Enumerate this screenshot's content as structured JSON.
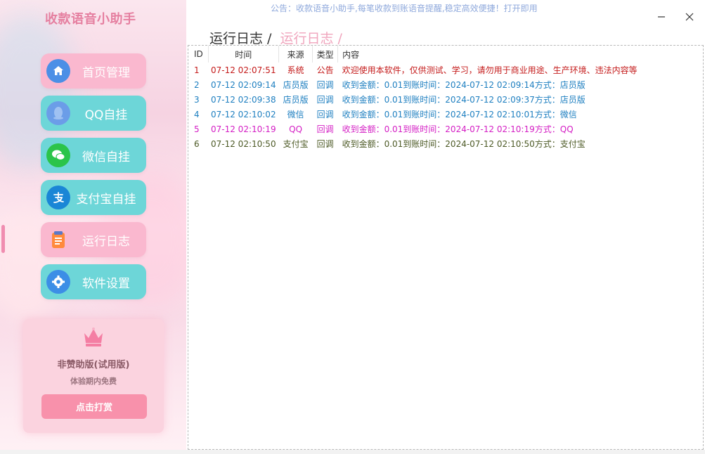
{
  "app": {
    "title": "收款语音小助手",
    "notice": "公告：收款语音小助手,每笔收款到账语音提醒,稳定高效便捷！打开即用"
  },
  "nav": [
    {
      "label": "首页管理",
      "icon": "home-icon",
      "style": "pink"
    },
    {
      "label": "QQ自挂",
      "icon": "qq-icon",
      "style": "teal"
    },
    {
      "label": "微信自挂",
      "icon": "wechat-icon",
      "style": "teal"
    },
    {
      "label": "支付宝自挂",
      "icon": "alipay-icon",
      "style": "teal"
    },
    {
      "label": "运行日志",
      "icon": "clipboard-icon",
      "style": "pink",
      "active": true
    },
    {
      "label": "软件设置",
      "icon": "gear-icon",
      "style": "teal"
    }
  ],
  "donate": {
    "version": "非赞助版(试用版)",
    "trial": "体验期内免费",
    "button": "点击打赏"
  },
  "breadcrumb": {
    "current": "运行日志 /",
    "sub": "运行日志 /"
  },
  "log": {
    "headers": {
      "id": "ID",
      "time": "时间",
      "source": "来源",
      "type": "类型",
      "content": "内容"
    },
    "rows": [
      {
        "id": "1",
        "time": "07-12 02:07:51",
        "source": "系统",
        "type": "公告",
        "content": "欢迎使用本软件，仅供测试、学习，请勿用于商业用途、生产环境、违法内容等",
        "color": "#c41a1a"
      },
      {
        "id": "2",
        "time": "07-12 02:09:14",
        "source": "店员版",
        "type": "回调",
        "content": "收到金额：0.01到账时间：2024-07-12 02:09:14方式：店员版",
        "color": "#1e7fc0"
      },
      {
        "id": "3",
        "time": "07-12 02:09:38",
        "source": "店员版",
        "type": "回调",
        "content": "收到金额：0.01到账时间：2024-07-12 02:09:37方式：店员版",
        "color": "#1e7fc0"
      },
      {
        "id": "4",
        "time": "07-12 02:10:02",
        "source": "微信",
        "type": "回调",
        "content": "收到金额：0.01到账时间：2024-07-12 02:10:01方式：微信",
        "color": "#1e7fc0"
      },
      {
        "id": "5",
        "time": "07-12 02:10:19",
        "source": "QQ",
        "type": "回调",
        "content": "收到金额：0.01到账时间：2024-07-12 02:10:19方式：QQ",
        "color": "#d41ec4"
      },
      {
        "id": "6",
        "time": "07-12 02:10:50",
        "source": "支付宝",
        "type": "回调",
        "content": "收到金额：0.01到账时间：2024-07-12 02:10:50方式：支付宝",
        "color": "#4d5a26"
      }
    ]
  }
}
